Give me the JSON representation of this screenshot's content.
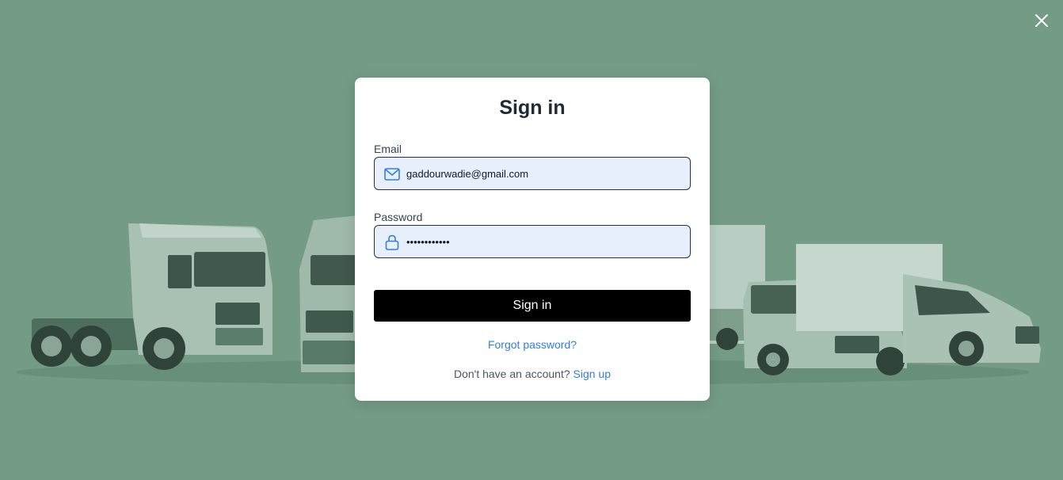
{
  "colors": {
    "background": "#739b85",
    "modal_bg": "#ffffff",
    "field_bg": "#e8effc",
    "icon_blue": "#2f7fe0",
    "link": "#2f7fe0",
    "button_bg": "#000000",
    "button_text": "#ffffff"
  },
  "background": {
    "image_icon": "trucks-fleet-illustration"
  },
  "window": {
    "close_icon": "close-icon"
  },
  "signin": {
    "title": "Sign in",
    "email": {
      "label": "Email",
      "value": "gaddourwadie@gmail.com",
      "icon": "mail-icon"
    },
    "password": {
      "label": "Password",
      "value": "••••••••••••",
      "icon": "lock-icon"
    },
    "submit_label": "Sign in",
    "forgot_label": "Forgot password?",
    "no_account_text": "Don't have an account?",
    "signup_label": "Sign up"
  }
}
